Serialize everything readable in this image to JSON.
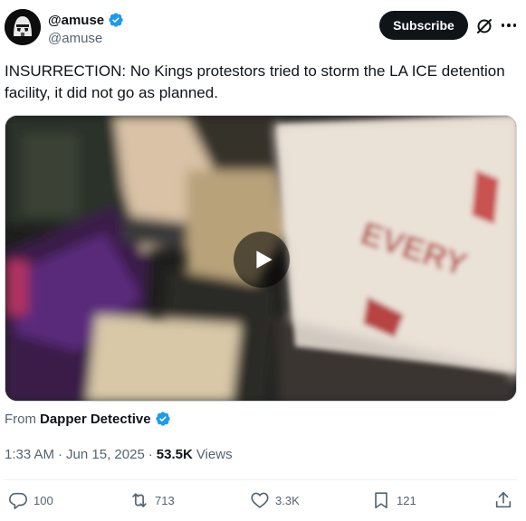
{
  "author": {
    "display_name": "@amuse",
    "handle": "@amuse",
    "verified": true
  },
  "header": {
    "subscribe_label": "Subscribe",
    "grok_icon": "grok-slash-icon",
    "more_icon": "more-horizontal-icon"
  },
  "tweet": {
    "text": "INSURRECTION: No Kings protestors tried to storm the LA ICE detention facility, it did not go as planned."
  },
  "media": {
    "type": "video",
    "play_icon": "play-icon",
    "visible_sign_text": "EVERY"
  },
  "attribution": {
    "from_label": "From",
    "source_name": "Dapper Detective",
    "verified": true
  },
  "meta": {
    "time": "1:33 AM",
    "separator": "·",
    "date": "Jun 15, 2025",
    "views_count": "53.5K",
    "views_label": "Views"
  },
  "actions": {
    "replies": "100",
    "reposts": "713",
    "likes": "3.3K",
    "bookmarks": "121"
  },
  "colors": {
    "verified_blue": "#1d9bf0",
    "text_primary": "#0f1419",
    "text_secondary": "#536471",
    "subscribe_bg": "#0f1419"
  }
}
